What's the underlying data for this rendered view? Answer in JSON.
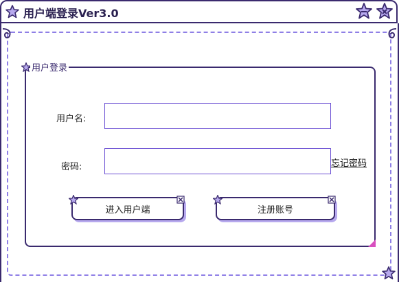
{
  "window": {
    "title": "用户端登录Ver3.0"
  },
  "group": {
    "title": "用户登录"
  },
  "form": {
    "username_label": "用户名:",
    "username_value": "",
    "password_label": "密码:",
    "password_value": "",
    "forgot_password": "忘记密码"
  },
  "buttons": {
    "enter": "进入用户端",
    "register": "注册账号"
  },
  "colors": {
    "accent": "#6b4fd3",
    "border": "#3a2a6e",
    "star_fill": "#b7a9ee"
  },
  "icons": [
    "star-icon",
    "minimize-star-icon",
    "close-star-icon"
  ]
}
